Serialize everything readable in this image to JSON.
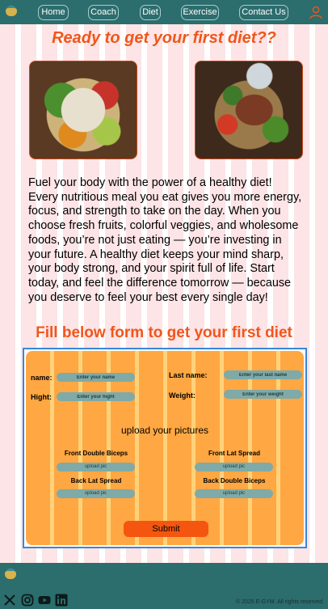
{
  "nav": {
    "items": [
      {
        "label": "Home"
      },
      {
        "label": "Coach"
      },
      {
        "label": "Diet"
      },
      {
        "label": "Exercise"
      },
      {
        "label": "Contact Us"
      }
    ],
    "icons": {
      "logo": "gym-logo",
      "user": "user-icon"
    }
  },
  "main": {
    "title": "Ready to get your first diet??",
    "paragraph": "Fuel your body with the power of a healthy diet! Every nutritious meal you eat gives you more energy, focus, and strength to take on the day. When you choose fresh fruits, colorful veggies, and wholesome foods, you’re not just eating — you’re investing in your future. A healthy diet keeps your mind sharp, your body strong, and your spirit full of life. Start today, and feel the difference tomorrow — because you deserve to feel your best every single day!",
    "form_heading": "Fill below form to get your first diet"
  },
  "form": {
    "name_label": "name:",
    "name_placeholder": "Enter your name",
    "lastname_label": "Last name:",
    "lastname_placeholder": "Enter your last name",
    "hight_label": "Hight:",
    "hight_placeholder": "Enter your hight",
    "weight_label": "Weight:",
    "weight_placeholder": "Enter your weight",
    "upload_title": "upload your pictures",
    "pics": [
      {
        "label": "Front Double Biceps",
        "button": "upload pic"
      },
      {
        "label": "Front Lat Spread",
        "button": "upload pic"
      },
      {
        "label": "Back Lat Spread",
        "button": "upload pic"
      },
      {
        "label": "Back Double Biceps",
        "button": "upload pic"
      }
    ],
    "submit_label": "Submit"
  },
  "footer": {
    "copyright": "© 2025 E-GYM. All rights reserved.",
    "social": [
      "x-icon",
      "instagram-icon",
      "youtube-icon",
      "linkedin-icon"
    ]
  },
  "colors": {
    "nav_bg": "#2c6d6e",
    "accent": "#f0561b",
    "form_bg": "#ffa742",
    "input_bg": "#7faaa8",
    "submit_bg": "#f5560f"
  }
}
